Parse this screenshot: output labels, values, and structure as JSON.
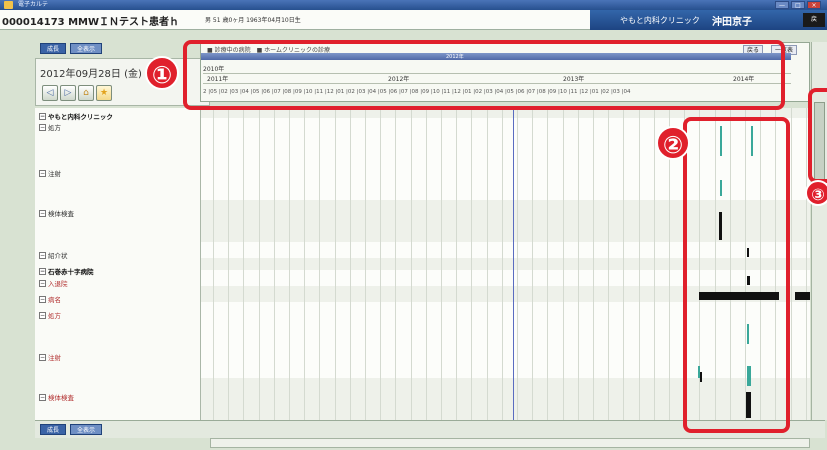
{
  "window": {
    "app_title": "電子カルテ",
    "buttons": [
      "—",
      "□",
      "×"
    ]
  },
  "patient": {
    "id_name": "000014173 MMWＩＮテスト患者ｈ",
    "info": "男 51 歳0ヶ月 1963年04月10日生",
    "clinic": "やもと内科クリニック",
    "doctor": "沖田京子",
    "corner_label": "戻"
  },
  "top_tabs": [
    {
      "label": "成長"
    },
    {
      "label": "全表示"
    }
  ],
  "date_panel": {
    "date": "2012年09月28日 (金)",
    "nav_icons": [
      "◁",
      "▷",
      "⌂",
      "★"
    ]
  },
  "timeline": {
    "legend": "■ 診療中の病院　■ ホームクリニックの診療",
    "track_label": "2012年",
    "buttons": [
      "戻る",
      "一覧表"
    ],
    "year_row": "2010年",
    "years": [
      {
        "label": "2011年"
      },
      {
        "label": "2012年"
      },
      {
        "label": "2013年"
      },
      {
        "label": "2014年"
      }
    ],
    "months": "2 |05 |02 |03 |04 |05 |06 |07 |08 |09 |10 |11 |12 |01 |02 |03 |04 |05 |06 |07 |08 |09 |10 |11 |12 |01 |02 |03 |04 |05 |06 |07 |08 |09 |10 |11 |12 |01 |02 |03 |04"
  },
  "tree": [
    {
      "label": "やもと内科クリニック",
      "style": "bold"
    },
    {
      "label": "処方",
      "style": "normal"
    },
    {
      "label": "注射",
      "style": "normal"
    },
    {
      "label": "検体検査",
      "style": "normal"
    },
    {
      "label": "紹介状",
      "style": "normal"
    },
    {
      "label": "石巻赤十字病院",
      "style": "bold"
    },
    {
      "label": "入退院",
      "style": "red"
    },
    {
      "label": "病名",
      "style": "red"
    },
    {
      "label": "処方",
      "style": "red"
    },
    {
      "label": "注射",
      "style": "red"
    },
    {
      "label": "検体検査",
      "style": "red"
    }
  ],
  "bottom_tabs": [
    {
      "label": "成長"
    },
    {
      "label": "全表示"
    }
  ],
  "callouts": [
    {
      "number": "①"
    },
    {
      "number": "②"
    },
    {
      "number": "③"
    }
  ],
  "colors": {
    "accent": "#3366aa",
    "highlight": "#e0202c",
    "teal_mark": "#3aa89a",
    "marker_line": "#5a6cc0"
  }
}
